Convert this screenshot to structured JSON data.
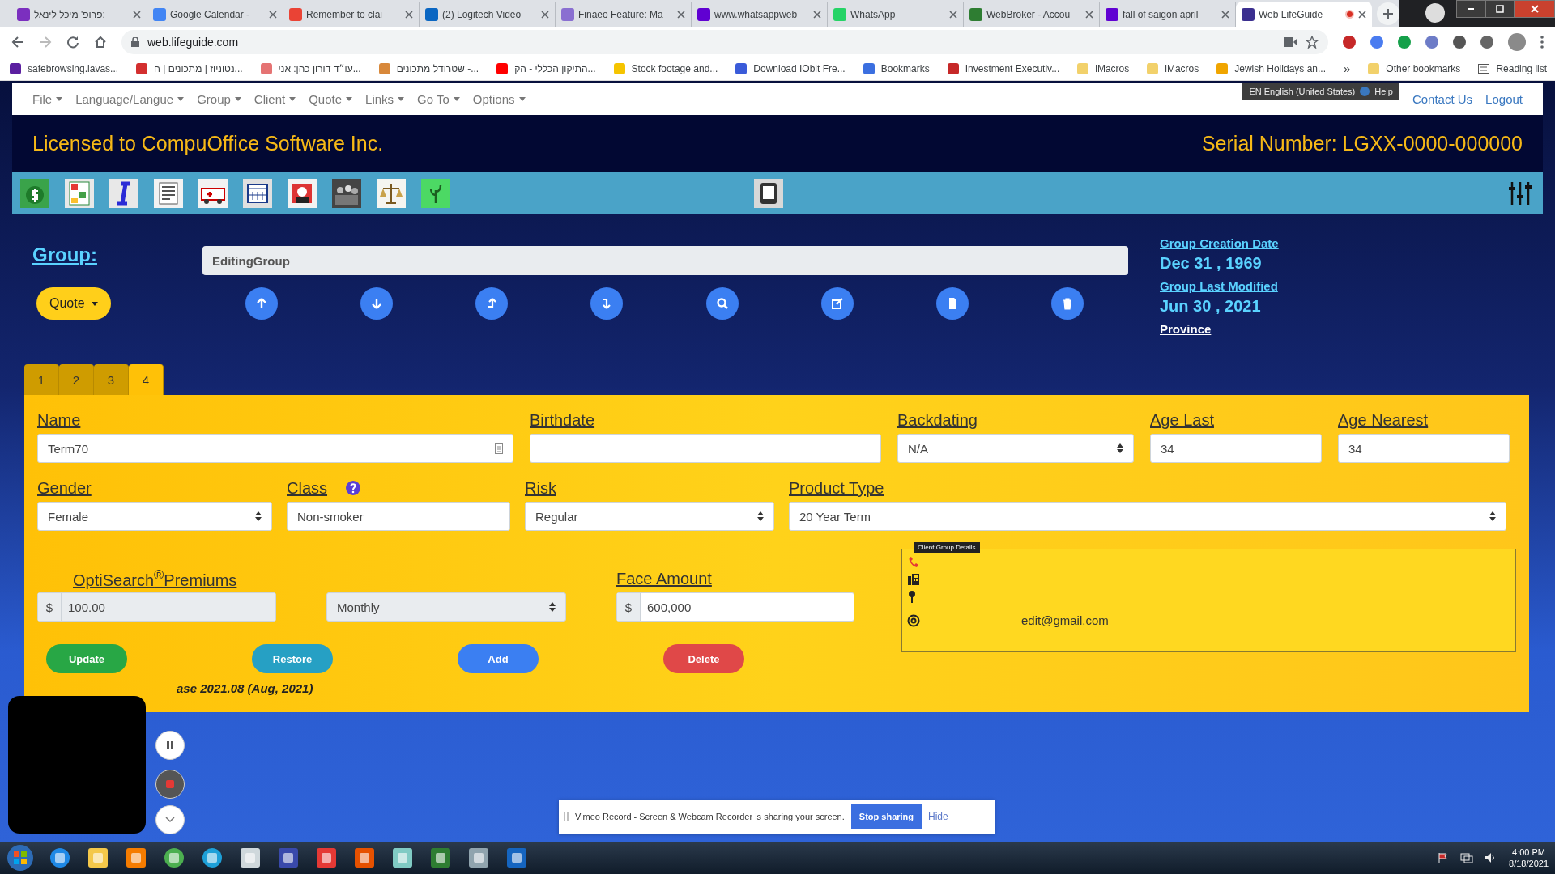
{
  "browser": {
    "tabs": [
      {
        "title": "פרופ' מיכל לינאל:",
        "selected": false,
        "recording": false
      },
      {
        "title": "Google Calendar -",
        "selected": false,
        "recording": false
      },
      {
        "title": "Remember to clai",
        "selected": false,
        "recording": false
      },
      {
        "title": "(2) Logitech Video",
        "selected": false,
        "recording": false
      },
      {
        "title": "Finaeo Feature: Ma",
        "selected": false,
        "recording": false
      },
      {
        "title": "www.whatsappweb",
        "selected": false,
        "recording": false
      },
      {
        "title": "WhatsApp",
        "selected": false,
        "recording": false
      },
      {
        "title": "WebBroker - Accou",
        "selected": false,
        "recording": false
      },
      {
        "title": "fall of saigon april",
        "selected": false,
        "recording": false
      },
      {
        "title": "Web LifeGuide",
        "selected": true,
        "recording": true
      }
    ],
    "address": "web.lifeguide.com",
    "bookmarks": [
      "safebrowsing.lavas...",
      "נטוניוז | מתכונים | ח...",
      "עו״ד דורון כהן: אני...",
      "שטרודל מתכונים -...",
      "התיקון הכללי - הק...",
      "Stock footage and...",
      "Download IObit Fre...",
      "Bookmarks",
      "Investment Executiv...",
      "iMacros",
      "iMacros",
      "Jewish Holidays an..."
    ],
    "bookmarks_more": "»",
    "other_bookmarks": "Other bookmarks",
    "reading_list": "Reading list"
  },
  "app": {
    "menu": [
      "File",
      "Language/Langue",
      "Group",
      "Client",
      "Quote",
      "Links",
      "Go To",
      "Options"
    ],
    "language": "EN English (United States)",
    "help": "Help",
    "links": [
      "Contact Us",
      "Logout"
    ],
    "license": "Licensed to CompuOffice Software Inc.",
    "serial": "Serial Number: LGXX-0000-000000"
  },
  "group": {
    "label": "Group:",
    "name": "EditingGroup",
    "quote_button": "Quote",
    "creation_label": "Group Creation Date",
    "creation_date": "Dec 31 , 1969",
    "modified_label": "Group Last Modified",
    "modified_date": "Jun 30 , 2021",
    "province_label": "Province"
  },
  "client_tabs": [
    {
      "label": "1",
      "selected": false
    },
    {
      "label": "2",
      "selected": false
    },
    {
      "label": "3",
      "selected": false
    },
    {
      "label": "4",
      "selected": true
    }
  ],
  "form": {
    "row1": [
      {
        "kind": "text-icon",
        "label": "Name",
        "value": "Term70"
      },
      {
        "kind": "text",
        "label": "Birthdate"
      },
      {
        "kind": "select",
        "label": "Backdating",
        "value": "N/A"
      },
      {
        "kind": "text",
        "label": "Age Last",
        "value": "34"
      },
      {
        "kind": "text",
        "label": "Age Nearest",
        "value": "34"
      }
    ],
    "row2": [
      {
        "kind": "select",
        "label": "Gender",
        "value": "Female"
      },
      {
        "kind": "text-help",
        "label": "Class",
        "value": "Non-smoker"
      },
      {
        "kind": "select",
        "label": "Risk",
        "value": "Regular"
      },
      {
        "kind": "select",
        "label": "Product Type",
        "value": "20 Year Term"
      }
    ],
    "premiums": {
      "label": "OptiSearch$^{®}$Premiums",
      "currency": "$",
      "amount": "100.00",
      "frequency": "Monthly",
      "disabled": true
    },
    "face_amount": {
      "label": "Face Amount",
      "currency": "$",
      "amount": "600,000"
    },
    "contact": {
      "tooltip": "Client Group Details",
      "email": "edit@gmail.com"
    },
    "buttons": [
      {
        "label": "Update",
        "kind": "update"
      },
      {
        "label": "Restore",
        "kind": "restore"
      },
      {
        "label": "Add",
        "kind": "add"
      },
      {
        "label": "Delete",
        "kind": "delete"
      }
    ],
    "release": "ase 2021.08 (Aug, 2021)"
  },
  "recorder": {
    "notice": "Vimeo Record - Screen & Webcam Recorder is sharing your screen.",
    "stop": "Stop sharing",
    "hide": "Hide"
  },
  "taskbar": {
    "time": "4:00 PM",
    "date": "8/18/2021"
  }
}
